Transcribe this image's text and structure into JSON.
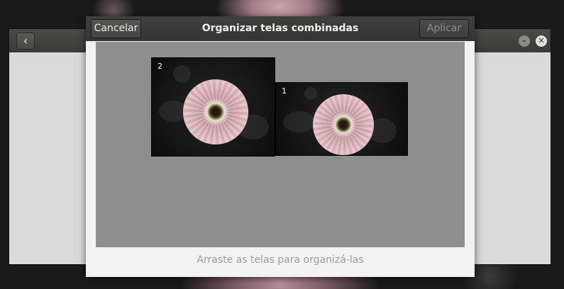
{
  "dialog": {
    "title": "Organizar telas combinadas",
    "cancel_label": "Cancelar",
    "apply_label": "Aplicar",
    "hint": "Arraste as telas para organizá-las"
  },
  "monitors": [
    {
      "number": "2",
      "wallpaper": "pink-gerbera-flower"
    },
    {
      "number": "1",
      "wallpaper": "pink-gerbera-flower"
    }
  ],
  "background_window": {
    "back_icon": "chevron-left-icon",
    "minimize_icon": "minimize-icon",
    "close_icon": "close-icon"
  },
  "colors": {
    "header": "#3a3a38",
    "arrange_area": "#8e8e8e",
    "dialog_bg": "#f2f2f2"
  }
}
